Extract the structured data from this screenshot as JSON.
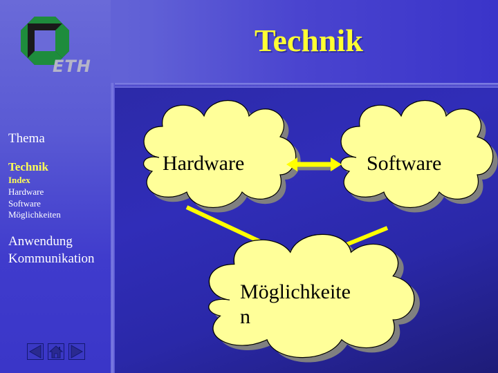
{
  "header": {
    "logo_text": "ETH",
    "title": "Technik"
  },
  "sidebar": {
    "sections": [
      {
        "label": "Thema"
      },
      {
        "label": "Technik",
        "active": true,
        "items": [
          {
            "label": "Index",
            "active": true
          },
          {
            "label": "Hardware"
          },
          {
            "label": "Software"
          },
          {
            "label": "Möglichkeiten"
          }
        ]
      },
      {
        "label": "Anwendung"
      },
      {
        "label": "Kommunikation"
      }
    ],
    "nav_buttons": [
      {
        "icon": "triangle-left-icon",
        "label": "previous"
      },
      {
        "icon": "home-icon",
        "label": "home"
      },
      {
        "icon": "triangle-right-icon",
        "label": "next"
      }
    ]
  },
  "diagram": {
    "nodes": [
      {
        "id": "hardware",
        "label": "Hardware"
      },
      {
        "id": "software",
        "label": "Software"
      },
      {
        "id": "moeglichkeiten",
        "label": "Möglichkeiten",
        "label_line1": "Möglichkeite",
        "label_line2": "n"
      }
    ],
    "edges": [
      {
        "from": "hardware",
        "to": "software",
        "type": "bidirectional"
      },
      {
        "from": "hardware",
        "to": "moeglichkeiten",
        "type": "directed"
      },
      {
        "from": "software",
        "to": "moeglichkeiten",
        "type": "directed"
      }
    ],
    "colors": {
      "cloud_fill": "#ffff99",
      "arrow": "#ffff00",
      "title": "#ffff33",
      "shadow": "#808080"
    }
  }
}
